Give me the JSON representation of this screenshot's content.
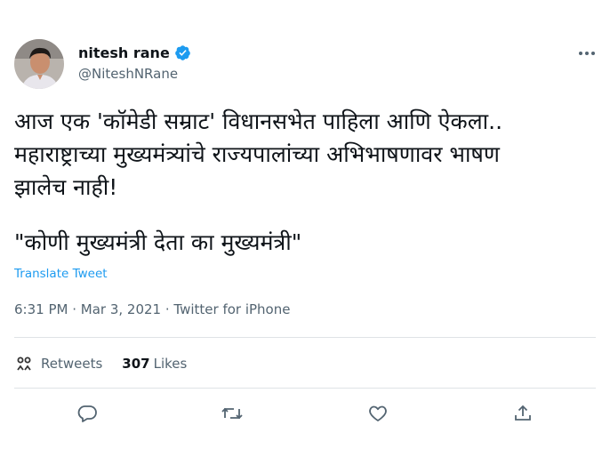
{
  "user": {
    "display_name": "nitesh rane",
    "handle": "@NiteshNRane",
    "verified": true
  },
  "tweet": {
    "text": "आज एक 'कॉमेडी सम्राट' विधानसभेत पाहिला आणि ऐकला..\nमहाराष्ट्राच्या मुख्यमंत्र्यांचे राज्यपालांच्या अभिभाषणावर भाषण\nझालेच नाही!",
    "quote": "\"कोणी मुख्यमंत्री देता का मुख्यमंत्री\"",
    "translate_label": "Translate Tweet",
    "time": "6:31 PM",
    "separator": " · ",
    "date": "Mar 3, 2021",
    "source": "Twitter for iPhone"
  },
  "stats": {
    "retweets_label": "Retweets",
    "likes_count": "307",
    "likes_label": "Likes"
  },
  "icons": {
    "more": "more-dots-icon",
    "verified": "verified-badge-icon",
    "reply": "reply-icon",
    "retweet": "retweet-icon",
    "like": "heart-icon",
    "share": "share-icon"
  },
  "colors": {
    "accent": "#1d9bf0",
    "text": "#0f1419",
    "muted": "#536471",
    "divider": "#dfe3e6"
  }
}
